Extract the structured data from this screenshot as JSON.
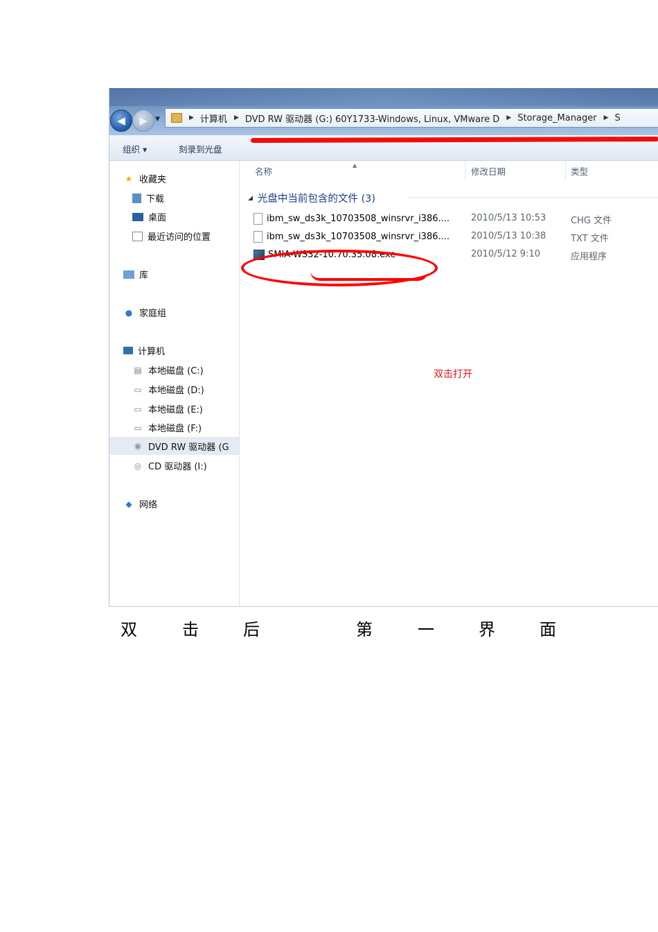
{
  "addressbar": {
    "crumbs": [
      "计算机",
      "DVD RW 驱动器 (G:) 60Y1733-Windows, Linux, VMware D",
      "Storage_Manager",
      "S"
    ]
  },
  "toolbar": {
    "organize": "组织 ▾",
    "burn": "刻录到光盘"
  },
  "sidebar": {
    "favorites": "收藏夹",
    "downloads": "下载",
    "desktop": "桌面",
    "recent": "最近访问的位置",
    "libraries": "库",
    "homegroup": "家庭组",
    "computer": "计算机",
    "drive_c": "本地磁盘 (C:)",
    "drive_d": "本地磁盘 (D:)",
    "drive_e": "本地磁盘 (E:)",
    "drive_f": "本地磁盘 (F:)",
    "drive_g": "DVD RW 驱动器 (G",
    "drive_i": "CD 驱动器 (I:)",
    "network": "网络"
  },
  "columns": {
    "name": "名称",
    "modified": "修改日期",
    "type": "类型"
  },
  "group_header": "光盘中当前包含的文件 (3)",
  "files": [
    {
      "name": "ibm_sw_ds3k_10703508_winsrvr_i386....",
      "date": "2010/5/13 10:53",
      "type": "CHG 文件"
    },
    {
      "name": "ibm_sw_ds3k_10703508_winsrvr_i386....",
      "date": "2010/5/13 10:38",
      "type": "TXT 文件"
    },
    {
      "name": "SMIA-WS32-10.70.35.08.exe",
      "date": "2010/5/12 9:10",
      "type": "应用程序"
    }
  ],
  "annotation": "双击打开",
  "caption": [
    "双",
    "击",
    "后",
    "第",
    "一",
    "界",
    "面"
  ],
  "colors": {
    "annotation_red": "#f30c0c",
    "link_blue": "#1f3b8c"
  }
}
